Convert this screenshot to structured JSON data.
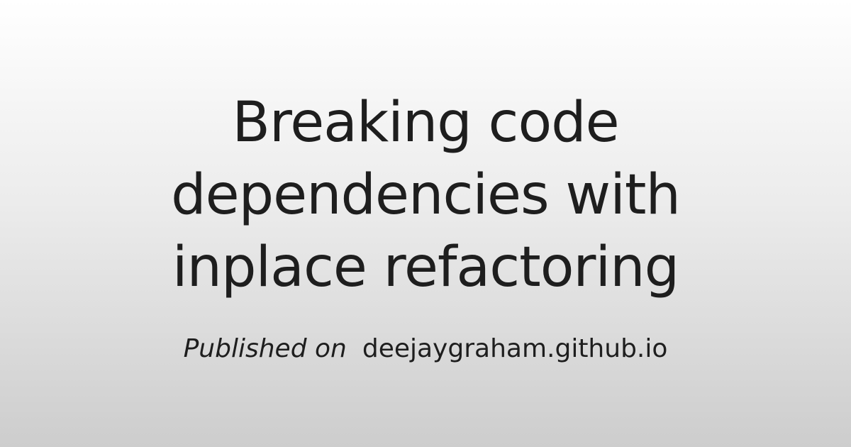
{
  "card": {
    "title": "Breaking code dependencies with inplace refactoring",
    "byline_prefix": "Published on",
    "site": "deejaygraham.github.io"
  }
}
